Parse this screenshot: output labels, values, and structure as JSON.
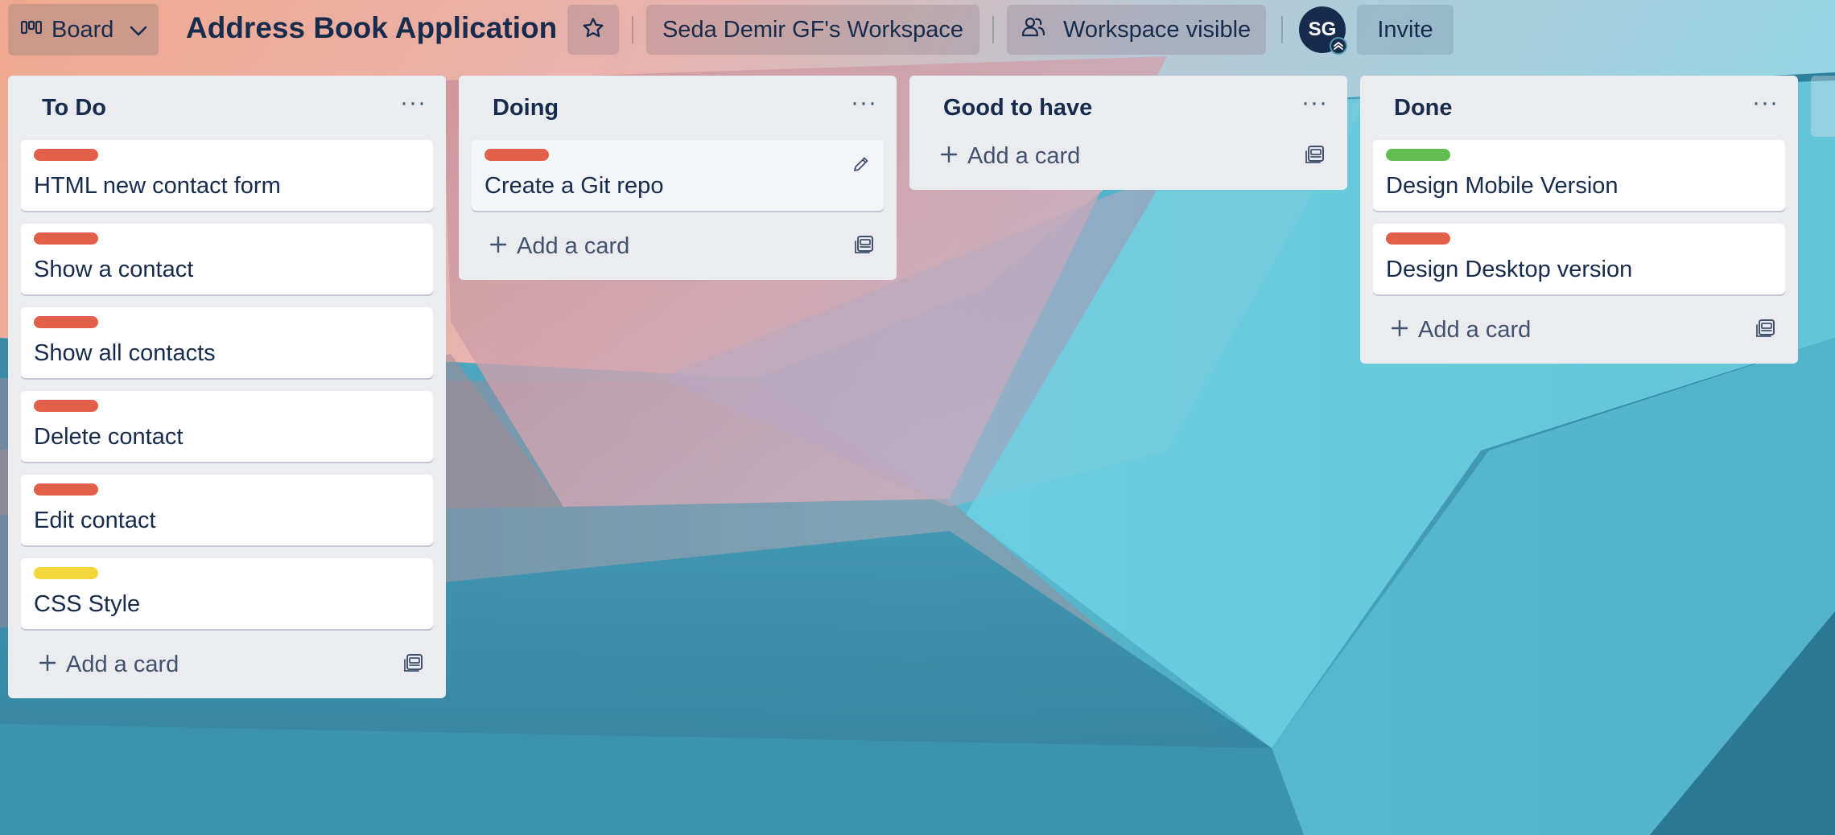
{
  "header": {
    "view_label": "Board",
    "title": "Address Book Application",
    "workspace": "Seda Demir GF's Workspace",
    "visibility": "Workspace visible",
    "avatar_initials": "SG",
    "invite_label": "Invite"
  },
  "colors": {
    "label_red": "#e2604a",
    "label_green": "#61bd4f",
    "label_yellow": "#f2d63a",
    "list_bg": "#ebecf0",
    "text": "#172b4d"
  },
  "lists": [
    {
      "title": "To Do",
      "cards": [
        {
          "label": "red",
          "title": "HTML new contact form"
        },
        {
          "label": "red",
          "title": "Show a contact"
        },
        {
          "label": "red",
          "title": "Show all contacts"
        },
        {
          "label": "red",
          "title": "Delete contact"
        },
        {
          "label": "red",
          "title": "Edit contact"
        },
        {
          "label": "yellow",
          "title": "CSS Style"
        }
      ],
      "add_card": "Add a card"
    },
    {
      "title": "Doing",
      "cards": [
        {
          "label": "red",
          "title": "Create a Git repo"
        }
      ],
      "add_card": "Add a card"
    },
    {
      "title": "Good to have",
      "cards": [],
      "add_card": "Add a card"
    },
    {
      "title": "Done",
      "cards": [
        {
          "label": "green",
          "title": "Design Mobile Version"
        },
        {
          "label": "red",
          "title": "Design Desktop version"
        }
      ],
      "add_card": "Add a card"
    }
  ],
  "icons": {
    "view": "board-icon",
    "chevron": "chevron-down-icon",
    "star": "star-icon",
    "visibility": "people-icon",
    "menu": "more-horizontal-icon",
    "add": "plus-icon",
    "template": "card-template-icon",
    "edit": "pencil-icon"
  }
}
